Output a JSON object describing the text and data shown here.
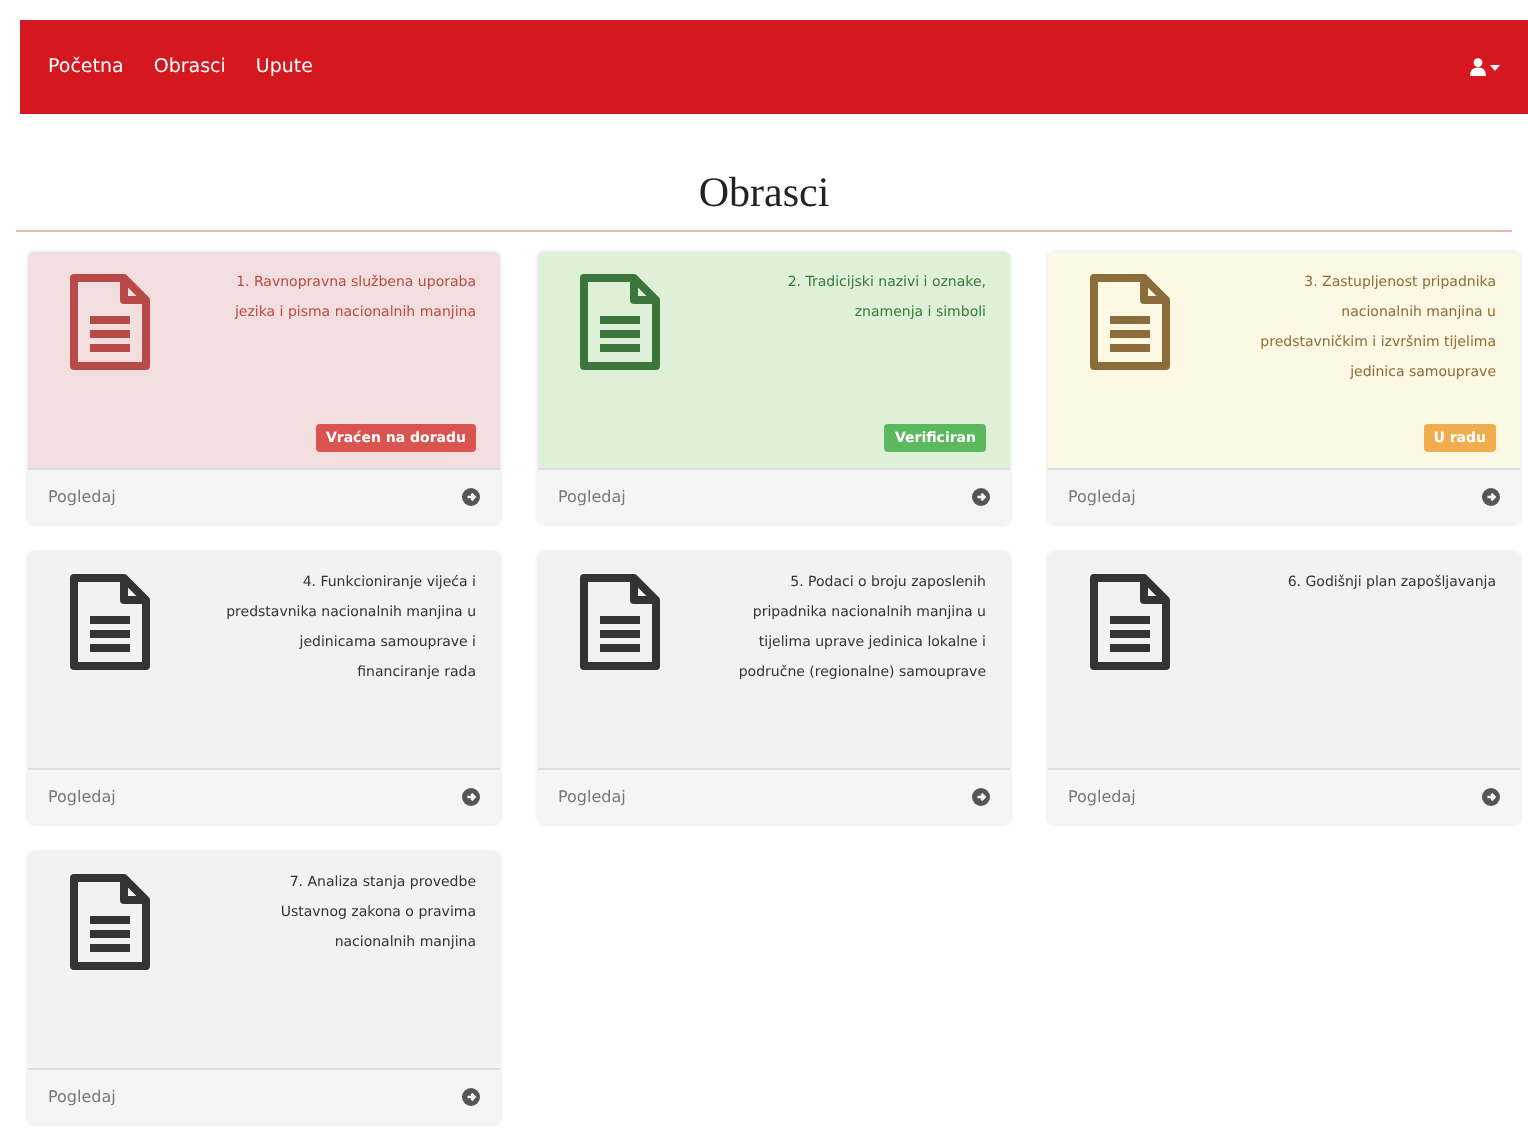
{
  "navbar": {
    "links": [
      {
        "label": "Početna"
      },
      {
        "label": "Obrasci"
      },
      {
        "label": "Upute"
      }
    ]
  },
  "page_title": "Obrasci",
  "forms": [
    {
      "title": "1. Ravnopravna službena uporaba jezika i pisma nacionalnih manjina",
      "status": {
        "kind": "returned",
        "label": "Vraćen na doradu"
      },
      "footer": "Pogledaj"
    },
    {
      "title": "2. Tradicijski nazivi i oznake, znamenja i simboli",
      "status": {
        "kind": "verified",
        "label": "Verificiran"
      },
      "footer": "Pogledaj"
    },
    {
      "title": "3. Zastupljenost pripadnika nacionalnih manjina u predstavničkim i izvršnim tijelima jedinica samouprave",
      "status": {
        "kind": "in_progress",
        "label": "U radu"
      },
      "footer": "Pogledaj"
    },
    {
      "title": "4. Funkcioniranje vijeća i predstavnika nacionalnih manjina u jedinicama samouprave i financiranje rada",
      "footer": "Pogledaj"
    },
    {
      "title": "5. Podaci o broju zaposlenih pripadnika nacionalnih manjina u tijelima uprave jedinica lokalne i područne (regionalne) samouprave",
      "footer": "Pogledaj"
    },
    {
      "title": "6. Godišnji plan zapošljavanja",
      "footer": "Pogledaj"
    },
    {
      "title": "7. Analiza stanja provedbe Ustavnog zakona o pravima nacionalnih manjina",
      "footer": "Pogledaj"
    }
  ]
}
